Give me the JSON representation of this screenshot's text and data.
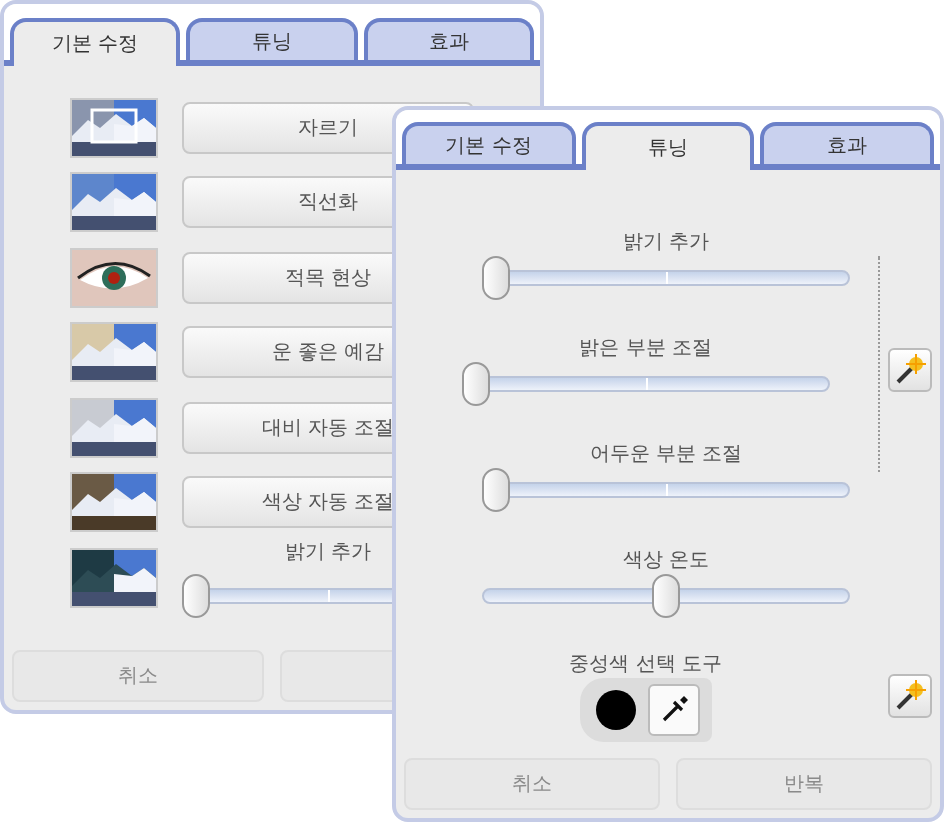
{
  "back_panel": {
    "tabs": [
      {
        "label": "기본 수정",
        "selected": true
      },
      {
        "label": "튜닝",
        "selected": false
      },
      {
        "label": "효과",
        "selected": false
      }
    ],
    "tools": [
      {
        "kind": "button",
        "label": "자르기"
      },
      {
        "kind": "button",
        "label": "직선화"
      },
      {
        "kind": "button",
        "label": "적목 현상"
      },
      {
        "kind": "button",
        "label": "운 좋은 예감"
      },
      {
        "kind": "button",
        "label": "대비 자동 조절"
      },
      {
        "kind": "button",
        "label": "색상 자동 조절"
      },
      {
        "kind": "slider",
        "label": "밝기 추가",
        "level": 0
      }
    ],
    "buttons": [
      {
        "label": "취소",
        "disabled": true
      },
      {
        "disabled": true
      }
    ]
  },
  "front_panel": {
    "tabs": [
      {
        "label": "기본 수정",
        "selected": false
      },
      {
        "label": "튜닝",
        "selected": true
      },
      {
        "label": "효과",
        "selected": false
      }
    ],
    "sliders": [
      {
        "label": "밝기 추가",
        "level": 0
      },
      {
        "label": "밝은 부분 조절",
        "level": 0
      },
      {
        "label": "어두운 부분 조절",
        "level": 0
      },
      {
        "label": "색상 온도",
        "level": 0.5
      }
    ],
    "neutral_picker": {
      "label": "중성색 선택 도구",
      "color": "#000000"
    },
    "buttons": [
      {
        "label": "취소",
        "disabled": true
      },
      {
        "label": "반복",
        "disabled": true
      }
    ]
  }
}
